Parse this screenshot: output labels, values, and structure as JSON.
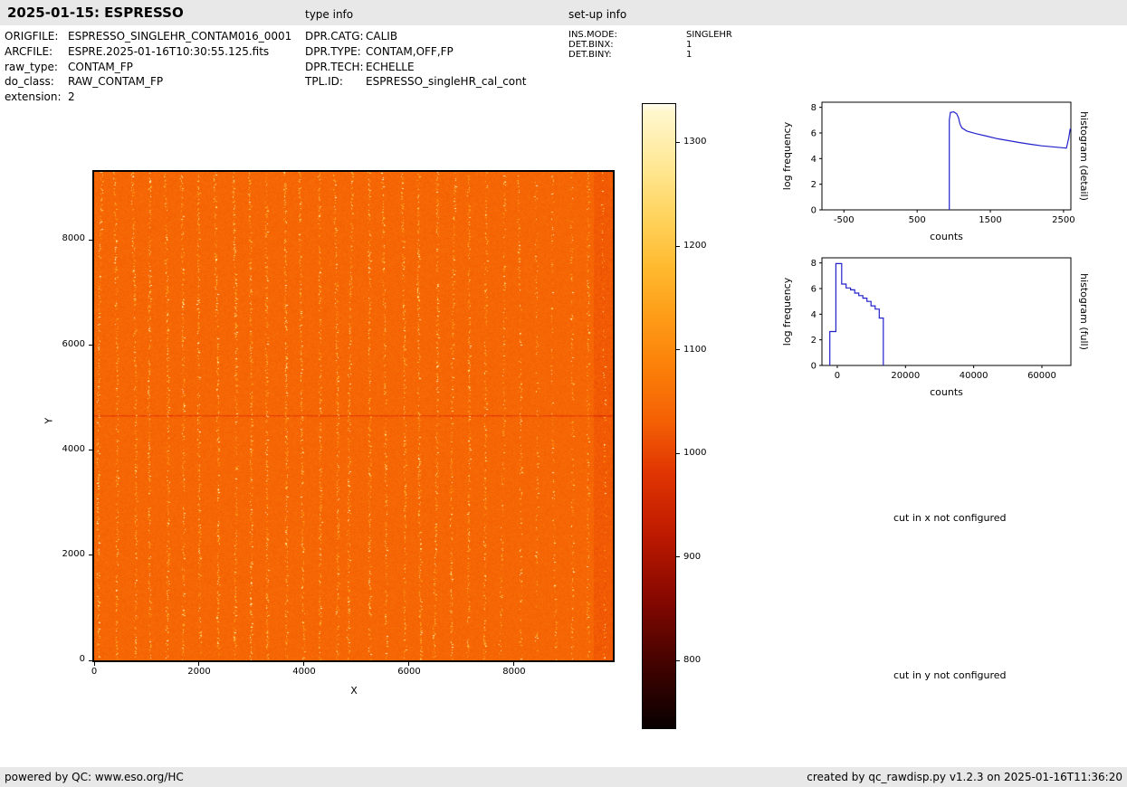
{
  "page": {
    "title": "2025-01-15: ESPRESSO",
    "section_labels": {
      "type_info": "type info",
      "setup_info": "set-up info"
    }
  },
  "metadata": {
    "file_info": [
      {
        "label": "ORIGFILE:",
        "value": "ESPRESSO_SINGLEHR_CONTAM016_0001"
      },
      {
        "label": "ARCFILE:",
        "value": "ESPRE.2025-01-16T10:30:55.125.fits"
      },
      {
        "label": "raw_type:",
        "value": "CONTAM_FP"
      },
      {
        "label": "do_class:",
        "value": "RAW_CONTAM_FP"
      },
      {
        "label": "extension:",
        "value": "2"
      }
    ],
    "type_info": [
      {
        "label": "DPR.CATG:",
        "value": "CALIB"
      },
      {
        "label": "DPR.TYPE:",
        "value": "CONTAM,OFF,FP"
      },
      {
        "label": "DPR.TECH:",
        "value": "ECHELLE"
      },
      {
        "label": "TPL.ID:",
        "value": "ESPRESSO_singleHR_cal_cont"
      }
    ],
    "setup_info": [
      {
        "label": "INS.MODE:",
        "value": "SINGLEHR"
      },
      {
        "label": "DET.BINX:",
        "value": "1"
      },
      {
        "label": "DET.BINY:",
        "value": "1"
      }
    ]
  },
  "messages": {
    "cut_x": "cut in x not configured",
    "cut_y": "cut in y not configured"
  },
  "footer": {
    "left": "powered by QC: www.eso.org/HC",
    "right": "created by qc_rawdisp.py v1.2.3 on 2025-01-16T11:36:20"
  },
  "chart_data": [
    {
      "id": "raw_image",
      "type": "heatmap",
      "xlabel": "X",
      "ylabel": "Y",
      "xlim": [
        0,
        9880
      ],
      "ylim": [
        0,
        9300
      ],
      "xticks": [
        0,
        2000,
        4000,
        6000,
        8000
      ],
      "yticks": [
        0,
        2000,
        4000,
        6000,
        8000
      ],
      "value_range": [
        735,
        1337
      ],
      "colorbar_ticks": [
        800,
        900,
        1000,
        1100,
        1200,
        1300
      ],
      "colormap": "hot (black-red-orange-yellow-white)",
      "background_level": 1042,
      "n_order_stripes": 31,
      "artifact_line_y": 4650,
      "description": "Raw ESPRESSO Fabry-Perot contamination frame: uniform orange background (~1040 counts) crossed by ~31 nearly vertical echelle-order stripes of bright yellow/white speckles; stripes fade around x=6900-8200; darker noisy band at right edge; thin dark horizontal artifact line near y=4650."
    },
    {
      "id": "histogram_detail",
      "type": "line",
      "title": "histogram (detail)",
      "xlabel": "counts",
      "ylabel": "log frequency",
      "xlim": [
        -800,
        2600
      ],
      "ylim": [
        0,
        8.4
      ],
      "xticks": [
        -500,
        500,
        1500,
        2500
      ],
      "yticks": [
        0,
        2,
        4,
        6,
        8
      ],
      "line_color": "#2222cc",
      "points": [
        [
          940,
          0
        ],
        [
          940,
          7.0
        ],
        [
          955,
          7.6
        ],
        [
          1000,
          7.65
        ],
        [
          1040,
          7.5
        ],
        [
          1065,
          7.2
        ],
        [
          1085,
          6.7
        ],
        [
          1110,
          6.4
        ],
        [
          1180,
          6.15
        ],
        [
          1300,
          5.95
        ],
        [
          1450,
          5.75
        ],
        [
          1600,
          5.55
        ],
        [
          1750,
          5.4
        ],
        [
          1900,
          5.25
        ],
        [
          2050,
          5.12
        ],
        [
          2200,
          5.0
        ],
        [
          2350,
          4.92
        ],
        [
          2480,
          4.85
        ],
        [
          2540,
          4.82
        ],
        [
          2570,
          5.6
        ],
        [
          2590,
          6.3
        ],
        [
          2600,
          6.35
        ]
      ]
    },
    {
      "id": "histogram_full",
      "type": "line",
      "title": "histogram (full)",
      "xlabel": "counts",
      "ylabel": "log frequency",
      "xlim": [
        -4500,
        68500
      ],
      "ylim": [
        0,
        8.4
      ],
      "xticks": [
        0,
        20000,
        40000,
        60000
      ],
      "yticks": [
        0,
        2,
        4,
        6,
        8
      ],
      "line_color": "#2222cc",
      "points": [
        [
          -2200,
          0
        ],
        [
          -2200,
          2.65
        ],
        [
          -400,
          2.65
        ],
        [
          -400,
          7.95
        ],
        [
          1300,
          7.95
        ],
        [
          1300,
          6.35
        ],
        [
          2600,
          6.35
        ],
        [
          2600,
          6.05
        ],
        [
          3900,
          6.05
        ],
        [
          3900,
          5.9
        ],
        [
          5100,
          5.9
        ],
        [
          5100,
          5.65
        ],
        [
          6300,
          5.65
        ],
        [
          6300,
          5.45
        ],
        [
          7500,
          5.45
        ],
        [
          7500,
          5.25
        ],
        [
          8700,
          5.25
        ],
        [
          8700,
          5.0
        ],
        [
          9900,
          5.0
        ],
        [
          9900,
          4.65
        ],
        [
          11100,
          4.65
        ],
        [
          11100,
          4.4
        ],
        [
          12300,
          4.4
        ],
        [
          12300,
          3.7
        ],
        [
          13500,
          3.7
        ],
        [
          13500,
          0
        ]
      ]
    }
  ]
}
